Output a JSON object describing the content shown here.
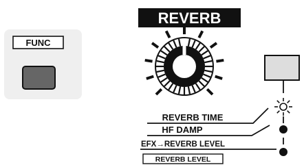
{
  "func_panel": {
    "label": "FUNC"
  },
  "reverb_section": {
    "title": "REVERB",
    "labels": [
      "REVERB TIME",
      "HF DAMP",
      "EFX→REVERB LEVEL",
      "REVERB LEVEL"
    ]
  },
  "indicators": [
    {
      "name": "reverb-time",
      "state": "blinking"
    },
    {
      "name": "hf-damp",
      "state": "lit"
    },
    {
      "name": "efx-reverb-level",
      "state": "lit"
    }
  ],
  "colors": {
    "panel_bg": "#efefef",
    "button_fill": "#666666",
    "switch_fill": "#dddddd",
    "title_bg": "#111111",
    "ink": "#111111"
  }
}
